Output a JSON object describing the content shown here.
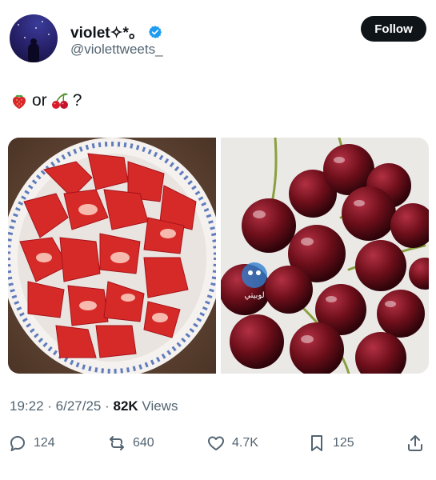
{
  "author": {
    "display_name": "violet✧*。",
    "handle": "@violettweets_",
    "verified": true
  },
  "follow_button": {
    "label": "Follow"
  },
  "tweet": {
    "text_word": "or",
    "text_question": "?",
    "emojis": [
      "strawberry",
      "cherries"
    ]
  },
  "media": {
    "left_subject": "strawberries-in-bowl",
    "right_subject": "cherries",
    "watermark_text": "لوبيتي"
  },
  "meta": {
    "time": "19:22",
    "sep1": " · ",
    "date": "6/27/25",
    "sep2": " · ",
    "views_count": "82K",
    "views_label": " Views"
  },
  "actions": {
    "replies": "124",
    "reposts": "640",
    "likes": "4.7K",
    "bookmarks": "125"
  },
  "colors": {
    "text_primary": "#0f1419",
    "text_secondary": "#536471",
    "verified_blue": "#1d9bf0",
    "follow_bg": "#0f1419",
    "strawberry_red": "#d8262b",
    "cherry_red": "#6e0f1a"
  },
  "icons": [
    "verified-badge-icon",
    "strawberry-emoji-icon",
    "cherries-emoji-icon",
    "reply-icon",
    "repost-icon",
    "like-icon",
    "bookmark-icon",
    "share-icon"
  ]
}
